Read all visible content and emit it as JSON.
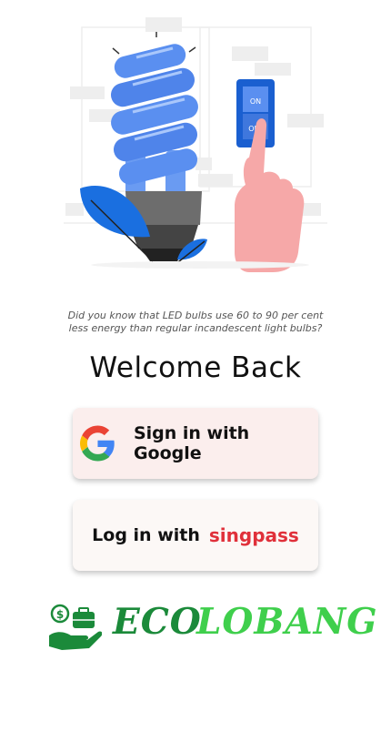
{
  "tip": {
    "line1": "Did you know that LED bulbs use 60 to 90 per cent",
    "line2": "less energy than regular incandescent light bulbs?"
  },
  "welcome_title": "Welcome Back",
  "google_button": {
    "label": "Sign in with Google",
    "icon": "google-g-icon"
  },
  "singpass_button": {
    "prefix": "Log in with",
    "brand": "singpass",
    "brand_color": "#e0303a"
  },
  "illustration": {
    "switch_on": "ON",
    "switch_off": "OFF",
    "bulb_color": "#5a8ff0"
  },
  "brand": {
    "part1": "ECO",
    "part2": "LOBANG",
    "color_dark": "#1b8a3a",
    "color_light": "#3fcf4c"
  }
}
